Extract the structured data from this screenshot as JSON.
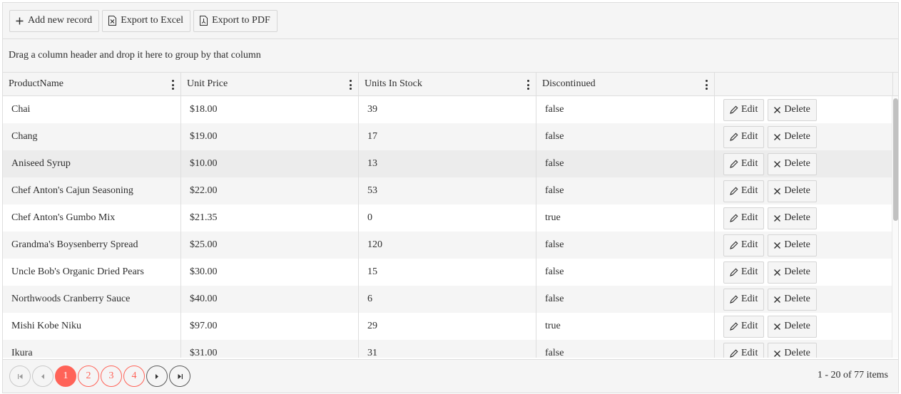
{
  "toolbar": {
    "add_label": "Add new record",
    "excel_label": "Export to Excel",
    "pdf_label": "Export to PDF"
  },
  "group_panel": {
    "text": "Drag a column header and drop it here to group by that column"
  },
  "columns": [
    "ProductName",
    "Unit Price",
    "Units In Stock",
    "Discontinued",
    ""
  ],
  "row_actions": {
    "edit_label": "Edit",
    "delete_label": "Delete"
  },
  "rows": [
    [
      "Chai",
      "$18.00",
      "39",
      "false"
    ],
    [
      "Chang",
      "$19.00",
      "17",
      "false"
    ],
    [
      "Aniseed Syrup",
      "$10.00",
      "13",
      "false"
    ],
    [
      "Chef Anton's Cajun Seasoning",
      "$22.00",
      "53",
      "false"
    ],
    [
      "Chef Anton's Gumbo Mix",
      "$21.35",
      "0",
      "true"
    ],
    [
      "Grandma's Boysenberry Spread",
      "$25.00",
      "120",
      "false"
    ],
    [
      "Uncle Bob's Organic Dried Pears",
      "$30.00",
      "15",
      "false"
    ],
    [
      "Northwoods Cranberry Sauce",
      "$40.00",
      "6",
      "false"
    ],
    [
      "Mishi Kobe Niku",
      "$97.00",
      "29",
      "true"
    ],
    [
      "Ikura",
      "$31.00",
      "31",
      "false"
    ]
  ],
  "pager": {
    "pages": [
      "1",
      "2",
      "3",
      "4"
    ],
    "current_page": "1",
    "info": "1 - 20 of 77 items"
  },
  "colors": {
    "accent": "#ff6358",
    "header_bg": "#f5f5f5",
    "border": "#dedede"
  },
  "icons": {
    "add": "plus-icon",
    "excel": "excel-file-icon",
    "pdf": "pdf-file-icon",
    "column_menu": "kebab-menu-icon",
    "edit": "pencil-icon",
    "delete": "close-icon",
    "first": "first-page-icon",
    "prev": "prev-page-icon",
    "next": "next-page-icon",
    "last": "last-page-icon"
  }
}
